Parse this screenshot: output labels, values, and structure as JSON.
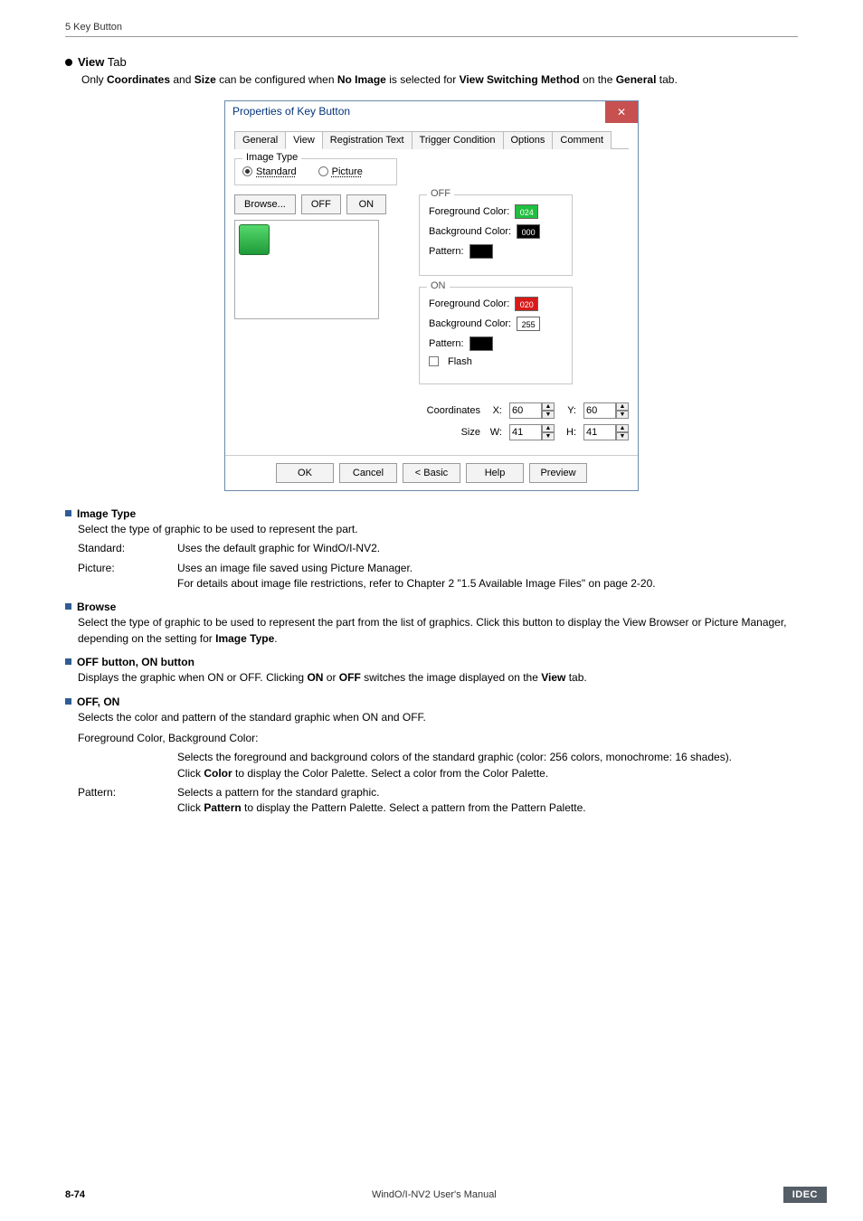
{
  "header": {
    "text": "5 Key Button"
  },
  "viewTab": {
    "title": "View",
    "titleSuffix": " Tab",
    "desc_a": "Only ",
    "desc_b": "Coordinates",
    "desc_c": " and ",
    "desc_d": "Size",
    "desc_e": " can be configured when ",
    "desc_f": "No Image",
    "desc_g": " is selected for ",
    "desc_h": "View Switching Method",
    "desc_i": " on the ",
    "desc_j": "General",
    "desc_k": " tab."
  },
  "dialog": {
    "title": "Properties of Key Button",
    "close": "✕",
    "tabs": {
      "general": "General",
      "view": "View",
      "reg": "Registration Text",
      "trig": "Trigger Condition",
      "opt": "Options",
      "comm": "Comment"
    },
    "imageType": {
      "legend": "Image Type",
      "standard": "Standard",
      "picture": "Picture"
    },
    "browse": "Browse...",
    "offBtn": "OFF",
    "onBtn": "ON",
    "off": {
      "legend": "OFF",
      "fg": "Foreground Color:",
      "fgVal": "024",
      "bg": "Background Color:",
      "bgVal": "000",
      "pattern": "Pattern:"
    },
    "on": {
      "legend": "ON",
      "fg": "Foreground Color:",
      "fgVal": "020",
      "bg": "Background Color:",
      "bgVal": "255",
      "pattern": "Pattern:",
      "flash": "Flash"
    },
    "coordsLabel": "Coordinates",
    "sizeLabel": "Size",
    "x": "X:",
    "y": "Y:",
    "w": "W:",
    "h": "H:",
    "xval": "60",
    "yval": "60",
    "wval": "41",
    "hval": "41",
    "ok": "OK",
    "cancel": "Cancel",
    "basic": "< Basic",
    "help": "Help",
    "preview": "Preview"
  },
  "sections": {
    "imageType": {
      "head": "Image Type",
      "desc": "Select the type of graphic to be used to represent the part.",
      "standardTerm": "Standard:",
      "standardVal": "Uses the default graphic for WindO/I-NV2.",
      "pictureTerm": "Picture:",
      "pictureVal1": "Uses an image file saved using Picture Manager.",
      "pictureVal2": "For details about image file restrictions, refer to Chapter 2 \"1.5 Available Image Files\" on page 2-20."
    },
    "browse": {
      "head": "Browse",
      "desc_a": "Select the type of graphic to be used to represent the part from the list of graphics. Click this button to display the View Browser or Picture Manager, depending on the setting for ",
      "desc_b": "Image Type",
      "desc_c": "."
    },
    "offon": {
      "head": "OFF button, ON button",
      "desc_a": "Displays the graphic when ON or OFF. Clicking ",
      "desc_b": "ON",
      "desc_c": " or ",
      "desc_d": "OFF",
      "desc_e": " switches the image displayed on the ",
      "desc_f": "View",
      "desc_g": " tab."
    },
    "offonColors": {
      "head": "OFF, ON",
      "desc": "Selects the color and pattern of the standard graphic when ON and OFF.",
      "fgbg": "Foreground Color, Background Color:",
      "fgbgDesc1": "Selects the foreground and background colors of the standard graphic (color: 256 colors, monochrome: 16 shades).",
      "fgbgDesc2a": "Click ",
      "fgbgDesc2b": "Color",
      "fgbgDesc2c": " to display the Color Palette. Select a color from the Color Palette.",
      "patternTerm": "Pattern:",
      "patternVal1": "Selects a pattern for the standard graphic.",
      "patternVal2a": "Click ",
      "patternVal2b": "Pattern",
      "patternVal2c": " to display the Pattern Palette. Select a pattern from the Pattern Palette."
    }
  },
  "footer": {
    "page": "8-74",
    "mid": "WindO/I-NV2 User's Manual",
    "brand": "IDEC"
  }
}
